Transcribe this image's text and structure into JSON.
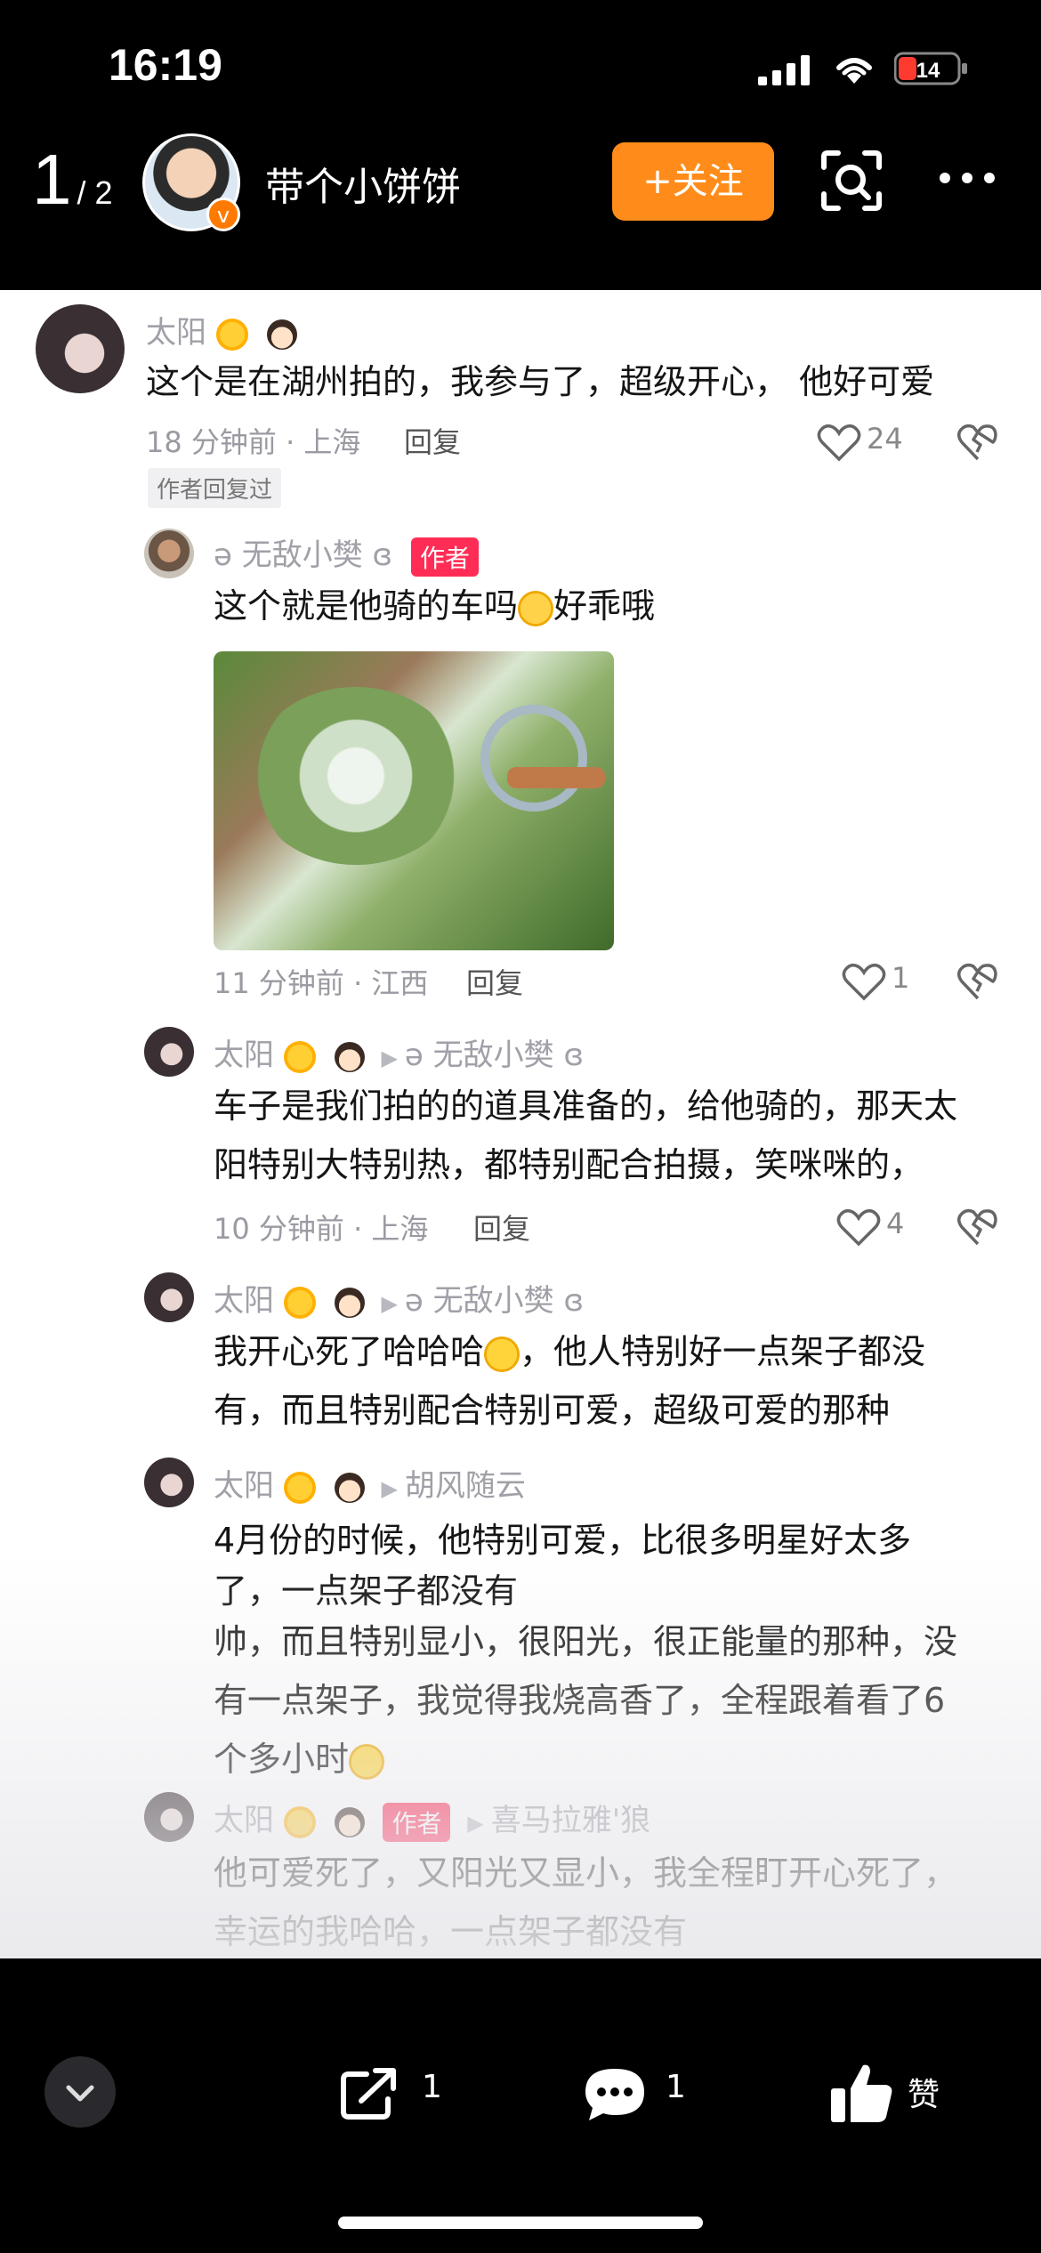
{
  "status": {
    "time": "16:19",
    "battery_text": "14"
  },
  "header": {
    "page_current": "1",
    "page_total": "/ 2",
    "username": "带个小饼饼",
    "follow_label": "+关注"
  },
  "comments": [
    {
      "nick": "太阳",
      "text": "这个是在湖州拍的，我参与了，超级开心， 他好可爱",
      "time_loc": "18 分钟前 · 上海",
      "reply_label": "回复",
      "likes": "24",
      "author_replied": "作者回复过"
    },
    {
      "nick": "ə 无敌小樊 ɞ",
      "author_tag": "作者",
      "text": "这个就是他骑的车吗",
      "text_suffix": "好乖哦",
      "time_loc": "11 分钟前 · 江西",
      "reply_label": "回复",
      "likes": "1"
    },
    {
      "nick": "太阳",
      "reply_to": "ə 无敌小樊 ɞ",
      "line1": "车子是我们拍的的道具准备的，给他骑的，那天太",
      "line2": "阳特别大特别热，都特别配合拍摄，笑咪咪的，",
      "time_loc": "10 分钟前 · 上海",
      "reply_label": "回复",
      "likes": "4"
    },
    {
      "nick": "太阳",
      "reply_to": "ə 无敌小樊 ɞ",
      "line1a": "我开心死了哈哈哈",
      "line1b": "，他人特别好一点架子都没",
      "line2": "有，而且特别配合特别可爱，超级可爱的那种"
    },
    {
      "nick": "太阳",
      "reply_to": "胡风随云",
      "line1": "4月份的时候，他特别可爱，比很多明星好太多",
      "line2": "了，一点架子都没有",
      "line3": "帅，而且特别显小，很阳光，很正能量的那种，没",
      "line4": "有一点架子，我觉得我烧高香了，全程跟着看了6",
      "line5": "个多小时"
    },
    {
      "nick": "太阳",
      "author_tag": "作者",
      "reply_to": "喜马拉雅'狼",
      "line1": "他可爱死了，又阳光又显小，我全程盯开心死了，",
      "line2": "幸运的我哈哈，一点架子都没有"
    }
  ],
  "bottom": {
    "share_count": "1",
    "comment_count": "1",
    "like_label": "赞"
  },
  "colors": {
    "follow": "#ff8c1a",
    "author_tag": "#ff2d55"
  }
}
